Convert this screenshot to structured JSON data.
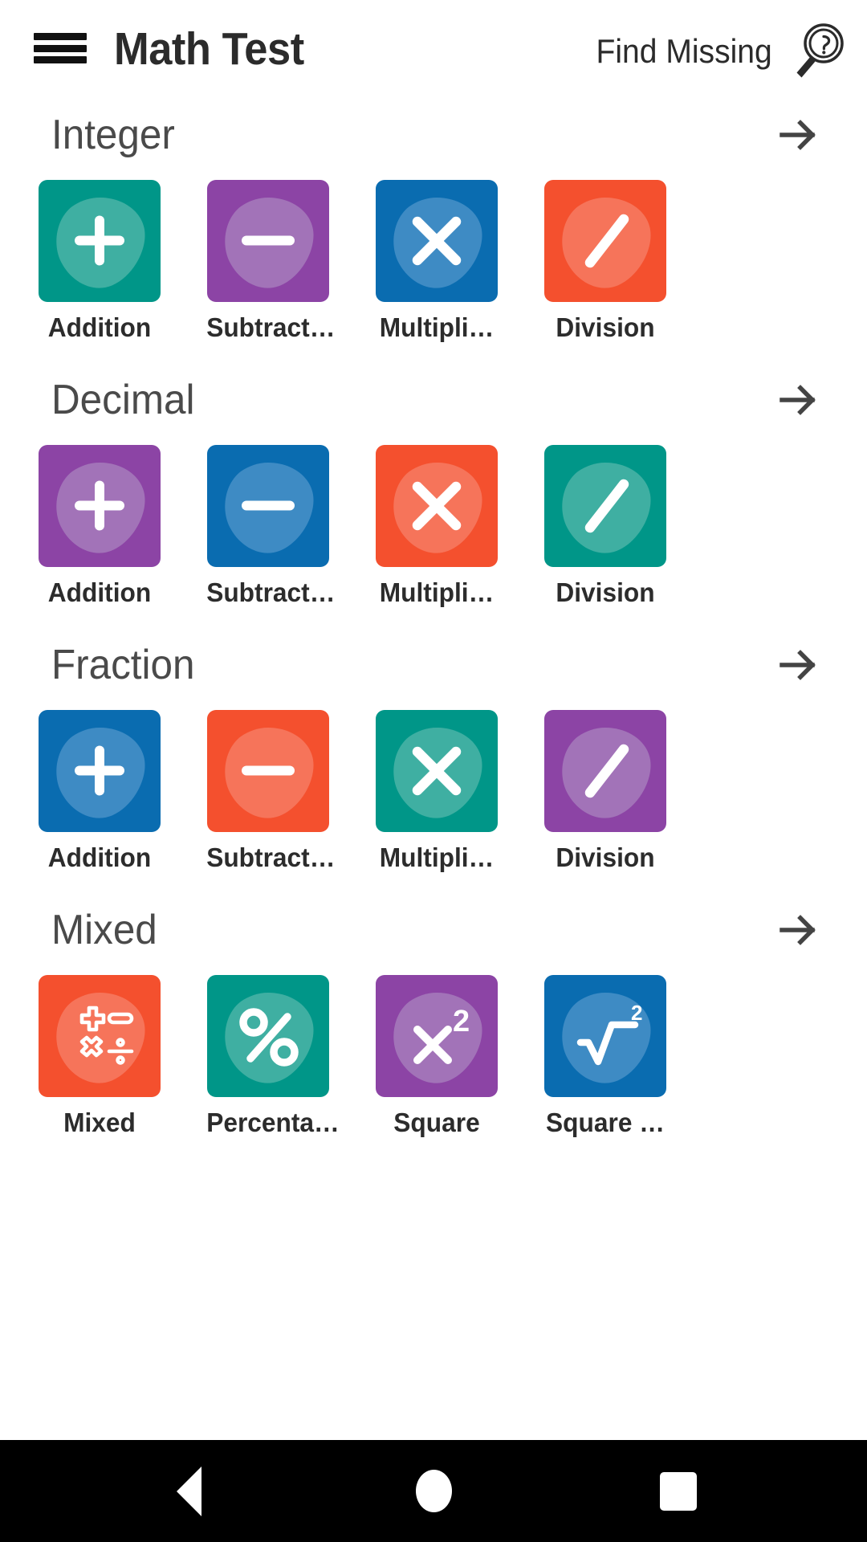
{
  "header": {
    "menu_icon": "hamburger-menu-icon",
    "title": "Math Test",
    "action_label": "Find Missing",
    "action_icon": "search-question-icon"
  },
  "colors": {
    "teal": "#009688",
    "purple": "#8C44A5",
    "blue": "#0A6CB0",
    "orange": "#F4502E",
    "text_dark": "#2c2c2c",
    "text_section": "#4a4a4a",
    "navbar": "#000000"
  },
  "sections": [
    {
      "title": "Integer",
      "arrow_icon": "arrow-right-icon",
      "tiles": [
        {
          "label": "Addition",
          "symbol": "plus",
          "color": "teal"
        },
        {
          "label": "Subtract…",
          "symbol": "minus",
          "color": "purple"
        },
        {
          "label": "Multipli…",
          "symbol": "times",
          "color": "blue"
        },
        {
          "label": "Division",
          "symbol": "slash",
          "color": "orange"
        }
      ]
    },
    {
      "title": "Decimal",
      "arrow_icon": "arrow-right-icon",
      "tiles": [
        {
          "label": "Addition",
          "symbol": "plus",
          "color": "purple"
        },
        {
          "label": "Subtract…",
          "symbol": "minus",
          "color": "blue"
        },
        {
          "label": "Multipli…",
          "symbol": "times",
          "color": "orange"
        },
        {
          "label": "Division",
          "symbol": "slash",
          "color": "teal"
        }
      ]
    },
    {
      "title": "Fraction",
      "arrow_icon": "arrow-right-icon",
      "tiles": [
        {
          "label": "Addition",
          "symbol": "plus",
          "color": "blue"
        },
        {
          "label": "Subtract…",
          "symbol": "minus",
          "color": "orange"
        },
        {
          "label": "Multipli…",
          "symbol": "times",
          "color": "teal"
        },
        {
          "label": "Division",
          "symbol": "slash",
          "color": "purple"
        }
      ]
    },
    {
      "title": "Mixed",
      "arrow_icon": "arrow-right-icon",
      "tiles": [
        {
          "label": "Mixed",
          "symbol": "mixed-ops",
          "color": "orange"
        },
        {
          "label": "Percenta…",
          "symbol": "percent",
          "color": "teal"
        },
        {
          "label": "Square",
          "symbol": "x-squared",
          "color": "purple"
        },
        {
          "label": "Square …",
          "symbol": "square-root",
          "color": "blue"
        }
      ]
    }
  ],
  "navbar": {
    "back_label": "Back",
    "home_label": "Home",
    "recents_label": "Recents"
  }
}
